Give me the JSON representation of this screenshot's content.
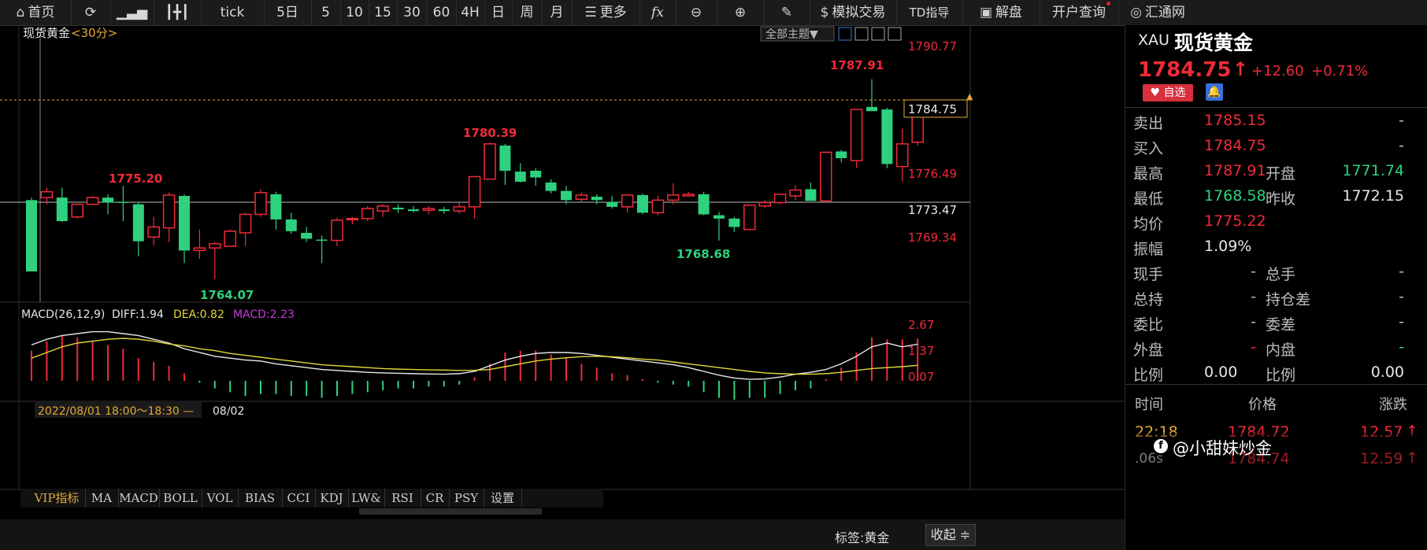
{
  "toolbar": {
    "home": "首页",
    "tick": "tick",
    "periods": [
      "5日",
      "5",
      "10",
      "15",
      "30",
      "60",
      "4H",
      "日",
      "周",
      "月"
    ],
    "more": "更多",
    "fx": "fx",
    "simulate": "模拟交易",
    "td": "TD指导",
    "decode": "解盘",
    "account": "开户查询",
    "brand": "汇通网"
  },
  "chart": {
    "title": "现货黄金",
    "period": "<30分>",
    "theme_select": "全部主题▼",
    "price_axis": [
      "1790.77",
      "1776.49",
      "1773.47",
      "1769.34"
    ],
    "current_price_tag": "1784.75",
    "annotations": {
      "high1": "1775.20",
      "high2": "1780.39",
      "high3": "1787.91",
      "low1": "1764.07",
      "low2": "1768.68"
    },
    "macd_label": "MACD(26,12,9)",
    "diff": "DIFF:1.94",
    "dea": "DEA:0.82",
    "macd": "MACD:2.23",
    "macd_axis": [
      "2.67",
      "1.37",
      "0.07"
    ],
    "time_label": "2022/08/01 18:00～18:30 —",
    "date_label": "08/02"
  },
  "bottom_tabs": [
    "VIP指标",
    "MA",
    "MACD",
    "BOLL",
    "VOL",
    "BIAS",
    "CCI",
    "KDJ",
    "LW&",
    "RSI",
    "CR",
    "PSY",
    "设置"
  ],
  "status": {
    "tag": "标签:黄金",
    "collapse": "收起"
  },
  "quote": {
    "code": "XAU",
    "name": "现货黄金",
    "price": "1784.75",
    "arrow": "↑",
    "change": "+12.60",
    "pct": "+0.71%",
    "fav": "自选",
    "rows": [
      {
        "k": "卖出",
        "v": "1785.15",
        "k2": "",
        "v2": "-"
      },
      {
        "k": "买入",
        "v": "1784.75",
        "k2": "",
        "v2": "-"
      },
      {
        "k": "最高",
        "v": "1787.91",
        "k2": "开盘",
        "v2": "1771.74"
      },
      {
        "k": "最低",
        "v": "1768.58",
        "k2": "昨收",
        "v2": "1772.15"
      },
      {
        "k": "均价",
        "v": "1775.22",
        "k2": "",
        "v2": ""
      },
      {
        "k": "振幅",
        "v": "1.09%",
        "k2": "",
        "v2": ""
      },
      {
        "k": "现手",
        "v": "-",
        "k2": "总手",
        "v2": "-"
      },
      {
        "k": "总持",
        "v": "-",
        "k2": "持仓差",
        "v2": "-"
      },
      {
        "k": "委比",
        "v": "-",
        "k2": "委差",
        "v2": "-"
      },
      {
        "k": "外盘",
        "v": "-",
        "k2": "内盘",
        "v2": "-"
      },
      {
        "k": "比例",
        "v": "0.00",
        "k2": "比例",
        "v2": "0.00"
      }
    ],
    "trade_headers": [
      "时间",
      "价格",
      "涨跌"
    ],
    "trades": [
      {
        "t": "22:18",
        "p": "1784.72",
        "c": "12.57"
      },
      {
        "t": ".06s",
        "p": "1784.74",
        "c": "12.59"
      }
    ],
    "watermark": "@小甜妹炒金"
  },
  "colors": {
    "up": "#ef2b39",
    "down": "#2fd17e",
    "bg": "#000000",
    "accent": "#e4a73a"
  },
  "chart_data": {
    "type": "candlestick",
    "y_range": [
      1762,
      1792
    ],
    "candles": [
      [
        1773.5,
        1773.8,
        1765.0,
        1765.0
      ],
      [
        1773.8,
        1775.0,
        1773.0,
        1774.5
      ],
      [
        1773.8,
        1775.0,
        1770.9,
        1771.0
      ],
      [
        1771.5,
        1773.0,
        1771.3,
        1773.0
      ],
      [
        1773.0,
        1774.0,
        1772.9,
        1773.8
      ],
      [
        1773.8,
        1774.2,
        1771.8,
        1773.2
      ],
      [
        1773.3,
        1775.2,
        1771.0,
        1773.2
      ],
      [
        1773.0,
        1773.3,
        1766.8,
        1768.6
      ],
      [
        1769.1,
        1771.5,
        1768.1,
        1770.3
      ],
      [
        1770.2,
        1774.4,
        1768.5,
        1774.1
      ],
      [
        1774.0,
        1774.2,
        1766.0,
        1767.5
      ],
      [
        1767.5,
        1770.0,
        1766.5,
        1767.8
      ],
      [
        1767.8,
        1768.5,
        1764.07,
        1768.3
      ],
      [
        1768.0,
        1770.0,
        1768.0,
        1769.8
      ],
      [
        1769.6,
        1772.0,
        1768.0,
        1771.8
      ],
      [
        1771.8,
        1774.8,
        1771.5,
        1774.4
      ],
      [
        1774.2,
        1774.5,
        1770.0,
        1771.2
      ],
      [
        1771.2,
        1772.0,
        1769.5,
        1769.8
      ],
      [
        1769.6,
        1770.3,
        1768.5,
        1768.9
      ],
      [
        1768.8,
        1769.3,
        1766.0,
        1768.7
      ],
      [
        1768.7,
        1771.4,
        1768.0,
        1771.1
      ],
      [
        1771.2,
        1771.5,
        1770.6,
        1771.3
      ],
      [
        1771.3,
        1772.8,
        1771.0,
        1772.5
      ],
      [
        1772.2,
        1773.0,
        1771.5,
        1772.8
      ],
      [
        1772.6,
        1773.0,
        1772.0,
        1772.4
      ],
      [
        1772.4,
        1772.8,
        1772.0,
        1772.2
      ],
      [
        1772.3,
        1772.8,
        1771.8,
        1772.5
      ],
      [
        1772.4,
        1772.7,
        1771.9,
        1772.2
      ],
      [
        1772.2,
        1773.2,
        1771.9,
        1772.7
      ],
      [
        1772.7,
        1776.3,
        1771.3,
        1776.3
      ],
      [
        1776.0,
        1780.39,
        1776.0,
        1780.2
      ],
      [
        1780.0,
        1780.2,
        1775.3,
        1777.0
      ],
      [
        1776.9,
        1777.9,
        1775.6,
        1775.7
      ],
      [
        1777.0,
        1777.3,
        1775.2,
        1776.2
      ],
      [
        1775.6,
        1776.0,
        1774.3,
        1774.6
      ],
      [
        1774.6,
        1775.2,
        1773.0,
        1773.5
      ],
      [
        1773.6,
        1774.4,
        1773.2,
        1774.1
      ],
      [
        1773.9,
        1774.2,
        1773.0,
        1773.5
      ],
      [
        1773.3,
        1774.0,
        1772.5,
        1772.7
      ],
      [
        1772.7,
        1774.1,
        1772.0,
        1774.1
      ],
      [
        1774.1,
        1774.3,
        1771.8,
        1772.0
      ],
      [
        1772.0,
        1774.0,
        1771.7,
        1773.5
      ],
      [
        1773.5,
        1775.5,
        1773.0,
        1774.1
      ],
      [
        1774.0,
        1774.5,
        1774.0,
        1774.2
      ],
      [
        1774.2,
        1774.5,
        1771.7,
        1771.8
      ],
      [
        1771.7,
        1772.1,
        1768.68,
        1771.3
      ],
      [
        1771.3,
        1771.5,
        1769.7,
        1770.3
      ],
      [
        1770.0,
        1773.0,
        1770.0,
        1772.9
      ],
      [
        1772.8,
        1773.5,
        1772.6,
        1773.2
      ],
      [
        1773.2,
        1774.2,
        1773.0,
        1774.2
      ],
      [
        1774.0,
        1775.3,
        1773.5,
        1774.7
      ],
      [
        1774.8,
        1775.6,
        1773.4,
        1773.4
      ],
      [
        1773.4,
        1779.3,
        1773.4,
        1779.2
      ],
      [
        1779.3,
        1779.5,
        1778.0,
        1778.5
      ],
      [
        1778.2,
        1784.3,
        1777.3,
        1784.3
      ],
      [
        1784.6,
        1787.91,
        1784.6,
        1784.1
      ],
      [
        1784.3,
        1784.5,
        1777.3,
        1777.8
      ],
      [
        1777.5,
        1782.0,
        1775.7,
        1780.2
      ],
      [
        1780.4,
        1784.8,
        1780.0,
        1784.75
      ]
    ],
    "macd_hist": [
      1.6,
      2.1,
      2.4,
      2.3,
      2.1,
      1.9,
      1.7,
      1.2,
      1.0,
      0.8,
      0.4,
      -0.1,
      -0.4,
      -0.6,
      -0.8,
      -0.7,
      -0.7,
      -0.8,
      -0.8,
      -0.9,
      -0.8,
      -0.7,
      -0.6,
      -0.5,
      -0.4,
      -0.4,
      -0.3,
      -0.3,
      -0.2,
      0.2,
      0.9,
      1.5,
      1.6,
      1.6,
      1.4,
      1.2,
      0.9,
      0.7,
      0.4,
      0.3,
      0.1,
      -0.1,
      -0.2,
      -0.3,
      -0.6,
      -0.9,
      -1.0,
      -0.9,
      -0.9,
      -0.7,
      -0.5,
      -0.4,
      0.1,
      0.7,
      1.5,
      2.3,
      2.2,
      2.2,
      2.23
    ],
    "diff": [
      1.9,
      2.2,
      2.4,
      2.5,
      2.6,
      2.6,
      2.5,
      2.4,
      2.2,
      2.0,
      1.7,
      1.5,
      1.3,
      1.2,
      1.1,
      1.05,
      0.9,
      0.8,
      0.7,
      0.6,
      0.55,
      0.5,
      0.45,
      0.42,
      0.4,
      0.38,
      0.36,
      0.35,
      0.38,
      0.5,
      0.8,
      1.1,
      1.3,
      1.45,
      1.5,
      1.5,
      1.45,
      1.35,
      1.25,
      1.15,
      1.05,
      0.95,
      0.85,
      0.7,
      0.5,
      0.3,
      0.15,
      0.08,
      0.1,
      0.2,
      0.35,
      0.45,
      0.6,
      0.9,
      1.3,
      1.8,
      2.0,
      1.8,
      1.94
    ],
    "dea": [
      1.2,
      1.5,
      1.8,
      2.0,
      2.1,
      2.2,
      2.25,
      2.2,
      2.1,
      1.95,
      1.85,
      1.7,
      1.6,
      1.45,
      1.35,
      1.25,
      1.15,
      1.05,
      0.95,
      0.85,
      0.8,
      0.75,
      0.7,
      0.65,
      0.62,
      0.6,
      0.58,
      0.57,
      0.55,
      0.56,
      0.6,
      0.75,
      0.9,
      1.05,
      1.15,
      1.22,
      1.28,
      1.3,
      1.28,
      1.22,
      1.15,
      1.1,
      1.0,
      0.9,
      0.8,
      0.7,
      0.6,
      0.5,
      0.42,
      0.38,
      0.35,
      0.35,
      0.38,
      0.45,
      0.55,
      0.65,
      0.7,
      0.75,
      0.82
    ]
  }
}
